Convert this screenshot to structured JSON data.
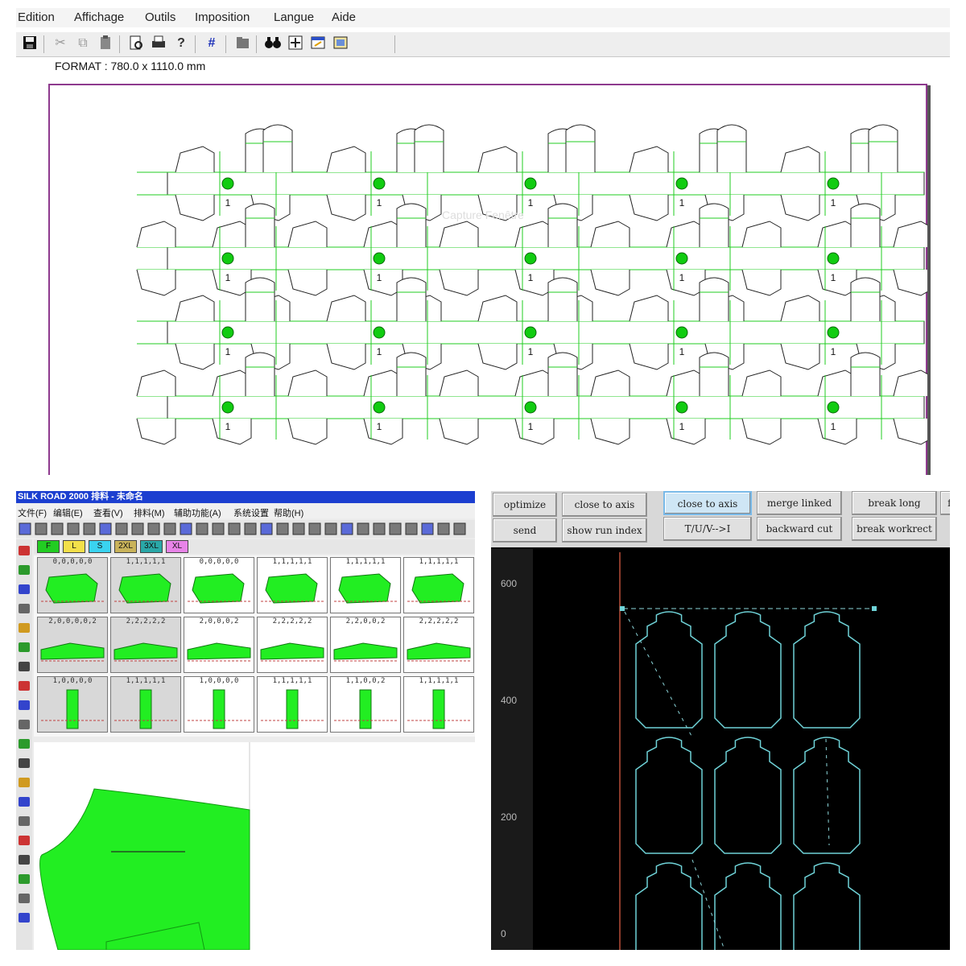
{
  "imposition": {
    "menu": [
      "Edition",
      "Affichage",
      "Outils",
      "Imposition",
      "Langue",
      "Aide"
    ],
    "format_label": "FORMAT : 780.0  x 1110.0 mm",
    "watermark": "Capture Fenêtre",
    "piece_number": "1",
    "colors": {
      "sheet_border": "#8e3a8e",
      "fold_lines": "#22cc22",
      "dot": "#11cc11"
    },
    "toolbar_icons": [
      "save-icon",
      "cut-icon",
      "copy-icon",
      "paste-icon",
      "preview-icon",
      "print-icon",
      "help-icon",
      "grid-icon",
      "folder-icon",
      "binoculars-icon",
      "fit-icon",
      "window-icon",
      "image-icon"
    ]
  },
  "cad": {
    "title": "SILK ROAD 2000 排料 - 未命名",
    "menu": [
      "文件(F)",
      "编辑(E)",
      "查看(V)",
      "排料(M)",
      "辅助功能(A)",
      "系统设置",
      "帮助(H)"
    ],
    "sizes": [
      "F",
      "L",
      "S",
      "2XL",
      "3XL",
      "XL"
    ],
    "size_colors": [
      "#22cc22",
      "#f3e04a",
      "#3ad3f0",
      "#c9b35a",
      "#2aa8a8",
      "#e884e8"
    ],
    "thumb_headers": [
      "0,0,0,0,0",
      "1,1,1,1,1",
      "0,0,0,0,0",
      "1,1,1,1,1",
      "1,1,1,1,1",
      "1,1,1,1,1",
      "2,0,0,0,0,2",
      "2,2,2,2,2",
      "2,0,0,0,2",
      "2,2,2,2,2",
      "2,2,0,0,2",
      "2,2,2,2,2",
      "1,0,0,0,0",
      "1,1,1,1,1",
      "1,0,0,0,0",
      "1,1,1,1,1",
      "1,1,0,0,2",
      "1,1,1,1,1"
    ],
    "piece_color": "#22ee22"
  },
  "cutter": {
    "buttons_row1": [
      "optimize",
      "close to axis",
      "close to axis",
      "merge linked",
      "break long",
      "fo"
    ],
    "buttons_row2": [
      "send",
      "show run index",
      "T/U/V-->I",
      "backward cut",
      "break workrect"
    ],
    "y_ticks": [
      "600",
      "400",
      "200",
      "0"
    ],
    "colors": {
      "contour": "#6fd3d8",
      "axis": "#8a3a2a",
      "background": "#000000"
    }
  }
}
